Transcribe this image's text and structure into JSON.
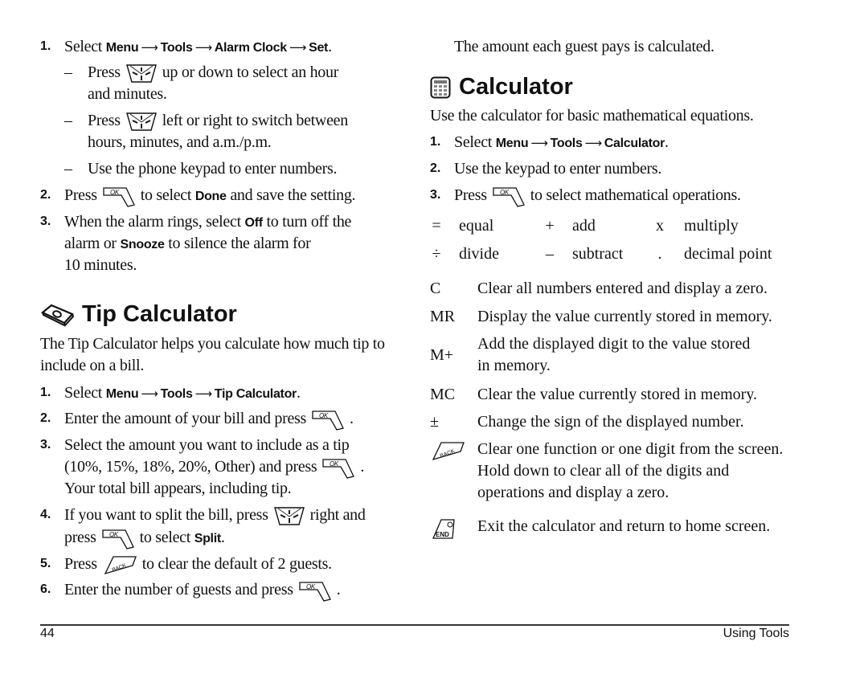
{
  "left": {
    "alarm_step1": {
      "num": "1.",
      "prefix": "Select ",
      "path": [
        "Menu",
        "Tools",
        "Alarm Clock",
        "Set"
      ],
      "suffix": "."
    },
    "alarm_sub": [
      {
        "dash": "–",
        "pre": "Press",
        "icon": "navigation-key-icon",
        "post": "up or down to select an hour",
        "cont": "and minutes."
      },
      {
        "dash": "–",
        "pre": "Press",
        "icon": "navigation-key-icon",
        "post": "left or right to switch between",
        "cont": "hours, minutes, and a.m./p.m."
      },
      {
        "dash": "–",
        "text": "Use the phone keypad to enter numbers."
      }
    ],
    "alarm_step2": {
      "num": "2.",
      "pre": "Press",
      "icon": "ok-key-icon",
      "mid": "to select ",
      "bold": "Done",
      "post": " and save the setting."
    },
    "alarm_step3": {
      "num": "3.",
      "l1_pre": "When the alarm rings, select ",
      "l1_bold": "Off",
      "l1_post": " to turn off the",
      "l2_pre": "alarm or ",
      "l2_bold": "Snooze",
      "l2_post": " to silence the alarm for",
      "l3": "10 minutes."
    },
    "tip_heading": "Tip Calculator",
    "tip_intro": [
      "The Tip Calculator helps you calculate how much tip to",
      "include on a bill."
    ],
    "tip_step1": {
      "num": "1.",
      "prefix": "Select ",
      "path": [
        "Menu",
        "Tools",
        "Tip Calculator"
      ],
      "suffix": "."
    },
    "tip_step2": {
      "num": "2.",
      "pre": "Enter the amount of your bill and press",
      "post": "."
    },
    "tip_step3": {
      "num": "3.",
      "l1": "Select the amount you want to include as a tip",
      "l2_pre": "(10%, 15%, 18%, 20%, Other) and press",
      "l2_post": ".",
      "l3": "Your total bill appears, including tip."
    },
    "tip_step4": {
      "num": "4.",
      "l1_pre": "If you want to split the bill, press",
      "l1_post": "right and",
      "l2_pre": "press",
      "l2_mid": "to select ",
      "l2_bold": "Split",
      "l2_post": "."
    },
    "tip_step5": {
      "num": "5.",
      "pre": "Press",
      "post": "to clear the default of 2 guests."
    },
    "tip_step6": {
      "num": "6.",
      "pre": "Enter the number of guests and press",
      "post": "."
    }
  },
  "right": {
    "guest_result": "The amount each guest pays is calculated.",
    "calc_heading": "Calculator",
    "calc_intro": "Use the calculator for basic mathematical equations.",
    "calc_step1": {
      "num": "1.",
      "prefix": "Select ",
      "path": [
        "Menu",
        "Tools",
        "Calculator"
      ],
      "suffix": "."
    },
    "calc_step2": {
      "num": "2.",
      "text": "Use the keypad to enter numbers."
    },
    "calc_step3": {
      "num": "3.",
      "pre": "Press",
      "post": "to select mathematical operations."
    },
    "operations": [
      {
        "symbol": "=",
        "label": "equal"
      },
      {
        "symbol": "+",
        "label": "add"
      },
      {
        "symbol": "x",
        "label": "multiply"
      },
      {
        "symbol": "÷",
        "label": "divide"
      },
      {
        "symbol": "–",
        "label": "subtract"
      },
      {
        "symbol": ".",
        "label": "decimal point"
      }
    ],
    "functions": [
      {
        "key": "C",
        "desc": [
          "Clear all numbers entered and display a zero."
        ]
      },
      {
        "key": "MR",
        "desc": [
          "Display the value currently stored in memory."
        ]
      },
      {
        "key": "M+",
        "desc": [
          "Add the displayed digit to the value stored",
          "in memory."
        ]
      },
      {
        "key": "MC",
        "desc": [
          "Clear the value currently stored in memory."
        ]
      },
      {
        "key": "±",
        "desc": [
          "Change the sign of the displayed number."
        ]
      },
      {
        "key_icon": "back-key-icon",
        "key_icon_label": "BACK",
        "desc": [
          "Clear one function or one digit from the screen.",
          "Hold down to clear all of the digits and",
          "operations and display a zero."
        ]
      },
      {
        "key_icon": "end-key-icon",
        "key_icon_label": "END",
        "desc": [
          "Exit the calculator and return to home screen."
        ]
      }
    ]
  },
  "footer": {
    "page_number": "44",
    "section": "Using Tools"
  },
  "icons": {
    "ok_label": "OK",
    "back_label": "BACK",
    "end_label": "END"
  }
}
